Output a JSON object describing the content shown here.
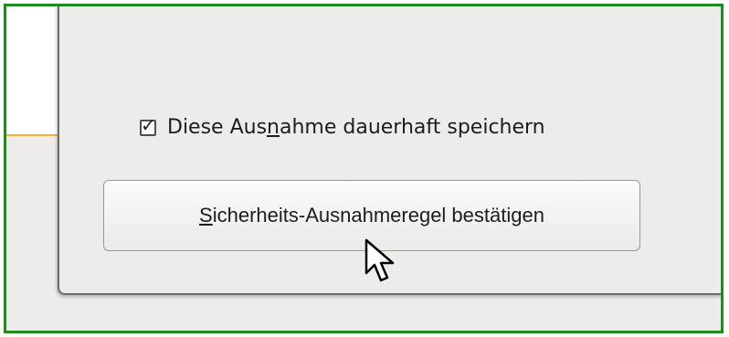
{
  "checkbox": {
    "checked": true,
    "label_before": "Diese Aus",
    "label_underlined": "n",
    "label_after": "ahme dauerhaft speichern"
  },
  "confirm_button": {
    "underlined": "S",
    "label_rest": "icherheits-Ausnahmeregel bestätigen"
  },
  "colors": {
    "frame_border": "#1f8a1f",
    "accent_line": "#f2b233",
    "dialog_bg": "#edecea"
  },
  "icons": {
    "check": "check-mark-icon",
    "pointer": "mouse-pointer-icon"
  }
}
